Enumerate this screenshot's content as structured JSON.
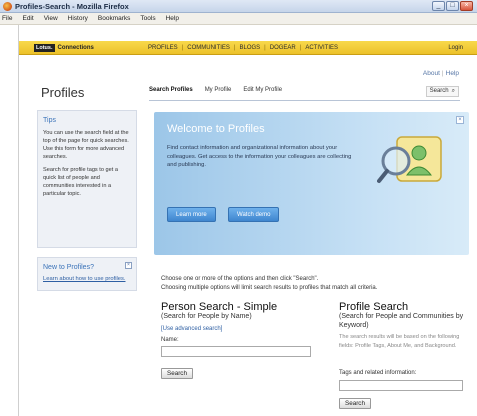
{
  "window": {
    "title": "Profiles-Search - Mozilla Firefox",
    "buttons": [
      "_",
      "□",
      "×"
    ]
  },
  "menu": [
    "File",
    "Edit",
    "View",
    "History",
    "Bookmarks",
    "Tools",
    "Help"
  ],
  "lotusbar": {
    "badge": "Lotus.",
    "product": "Connections",
    "nav": [
      "PROFILES",
      "COMMUNITIES",
      "BLOGS",
      "DOGEAR",
      "ACTIVITIES"
    ],
    "login": "Login"
  },
  "toplinks": {
    "about": "About",
    "help": "Help"
  },
  "header": {
    "title": "Profiles",
    "tabs": [
      "Search Profiles",
      "My Profile",
      "Edit My Profile"
    ],
    "search": "Search"
  },
  "tips": {
    "title": "Tips",
    "p1": "You can use the search field at the top of the page for quick searches. Use this form for more advanced searches.",
    "p2": "Search for profile tags to get a quick list of people and communities interested in a particular topic."
  },
  "new_box": {
    "title": "New to Profiles?",
    "link": "Learn about how to use profiles."
  },
  "welcome": {
    "title": "Welcome to Profiles",
    "text": "Find contact information and organizational information about your colleagues. Get access to the information your colleagues are collecting and publishing.",
    "learn_more": "Learn more",
    "watch_demo": "Watch demo"
  },
  "intro": {
    "line1": "Choose one or more of the options and then click \"Search\".",
    "line2": "Choosing multiple options will limit search results to profiles that match all criteria."
  },
  "person_search": {
    "title": "Person Search - Simple",
    "subtitle": "(Search for People by Name)",
    "advanced_link": "[Use advanced search]",
    "name_label": "Name:",
    "name_value": "",
    "button": "Search"
  },
  "profile_search": {
    "title": "Profile Search",
    "subtitle": "(Search for People and Communities by Keyword)",
    "note": "The search results will be based on the following fields: Profile Tags, About Me, and Background.",
    "tags_label": "Tags and related information:",
    "tags_value": "",
    "button": "Search"
  },
  "colors": {
    "lotus_yellow": "#f4d03f",
    "banner_blue": "#9cc6e8",
    "link_blue": "#2e5fa3"
  }
}
